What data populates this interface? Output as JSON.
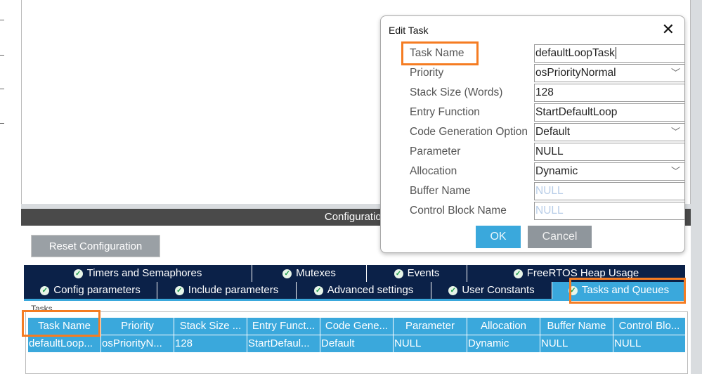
{
  "config_header": "Configuration",
  "reset_button": "Reset Configuration",
  "tabs_row1": [
    "Timers and Semaphores",
    "Mutexes",
    "Events",
    "FreeRTOS Heap Usage"
  ],
  "tabs_row2": [
    "Config parameters",
    "Include parameters",
    "Advanced settings",
    "User Constants",
    "Tasks and Queues"
  ],
  "active_tab": "Tasks and Queues",
  "tasks_group": "Tasks",
  "table": {
    "headers": [
      "Task Name",
      "Priority",
      "Stack Size ...",
      "Entry Funct...",
      "Code Gene...",
      "Parameter",
      "Allocation",
      "Buffer Name",
      "Control Blo..."
    ],
    "rows": [
      [
        "defaultLoop...",
        "osPriorityN...",
        "128",
        "StartDefaul...",
        "Default",
        "NULL",
        "Dynamic",
        "NULL",
        "NULL"
      ]
    ]
  },
  "dialog": {
    "title": "Edit Task",
    "fields": [
      {
        "label": "Task Name",
        "value": "defaultLoopTask",
        "type": "text"
      },
      {
        "label": "Priority",
        "value": "osPriorityNormal",
        "type": "select"
      },
      {
        "label": "Stack Size (Words)",
        "value": "128",
        "type": "text"
      },
      {
        "label": "Entry Function",
        "value": "StartDefaultLoop",
        "type": "text"
      },
      {
        "label": "Code Generation Option",
        "value": "Default",
        "type": "select"
      },
      {
        "label": "Parameter",
        "value": "NULL",
        "type": "text"
      },
      {
        "label": "Allocation",
        "value": "Dynamic",
        "type": "select"
      },
      {
        "label": "Buffer Name",
        "value": "NULL",
        "type": "placeholder"
      },
      {
        "label": "Control Block Name",
        "value": "NULL",
        "type": "placeholder"
      }
    ],
    "ok": "OK",
    "cancel": "Cancel"
  },
  "colors": {
    "accent": "#3aa8dc",
    "tab_dark": "#0b2148",
    "highlight": "#f57c22"
  }
}
